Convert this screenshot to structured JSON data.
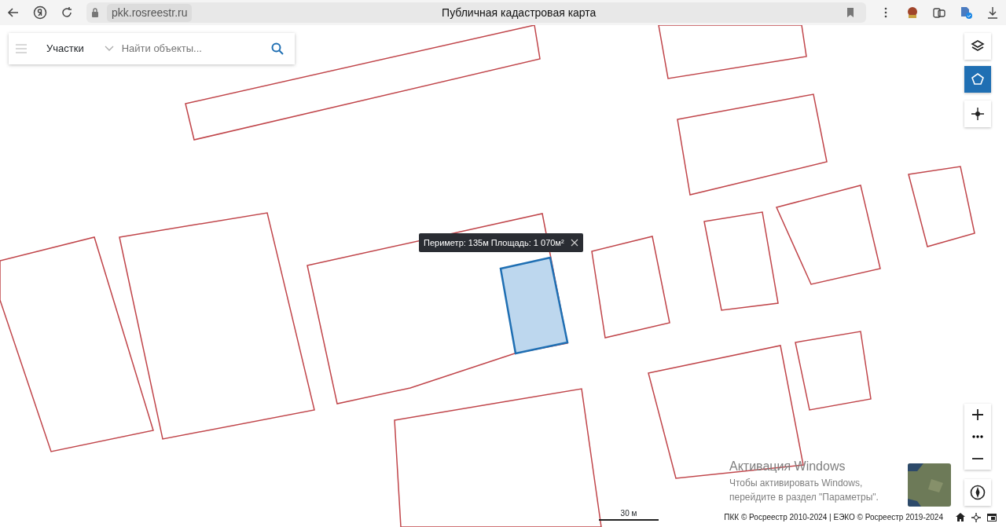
{
  "browser": {
    "address": "pkk.rosreestr.ru",
    "title": "Публичная кадастровая карта"
  },
  "search": {
    "layer": "Участки",
    "placeholder": "Найти объекты..."
  },
  "tools": [
    {
      "kind": "layers",
      "selected": false
    },
    {
      "kind": "polygon",
      "selected": true
    },
    {
      "kind": "locate",
      "selected": false
    }
  ],
  "measure": {
    "text": "Периметр: 135м Площадь: 1 070м²"
  },
  "scale": "30 м",
  "attribution": "ПКК © Росреестр 2010-2024 | ЕЭКО © Росреестр 2019-2024",
  "os_notice": {
    "title": "Активация Windows",
    "text": "Чтобы активировать Windows, перейдите в раздел \"Параметры\"."
  }
}
